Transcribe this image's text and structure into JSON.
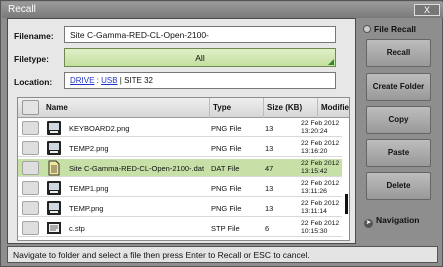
{
  "window": {
    "title": "Recall",
    "close_label": "X"
  },
  "form": {
    "filename_label": "Filename:",
    "filename_value": "Site C-Gamma-RED-CL-Open-2100-",
    "filetype_label": "Filetype:",
    "filetype_value": "All",
    "location_label": "Location:",
    "location_drive": "DRIVE",
    "location_sep1": " : ",
    "location_usb": "USB",
    "location_rest": " | SITE 32"
  },
  "table": {
    "headers": {
      "name": "Name",
      "type": "Type",
      "size": "Size (KB)",
      "modified": "Modified"
    },
    "sort_indicator": "chevron-down",
    "rows": [
      {
        "name": "KEYBOARD2.png",
        "type": "PNG File",
        "size": "13",
        "modified_date": "22 Feb 2012",
        "modified_time": "13:20:24",
        "icon": "image-file-icon",
        "selected": false
      },
      {
        "name": "TEMP2.png",
        "type": "PNG File",
        "size": "13",
        "modified_date": "22 Feb 2012",
        "modified_time": "13:16:20",
        "icon": "image-file-icon",
        "selected": false
      },
      {
        "name": "Site C-Gamma-RED-CL-Open-2100-.dat",
        "type": "DAT File",
        "size": "47",
        "modified_date": "22 Feb 2012",
        "modified_time": "13:15:42",
        "icon": "data-file-icon",
        "selected": true
      },
      {
        "name": "TEMP1.png",
        "type": "PNG File",
        "size": "13",
        "modified_date": "22 Feb 2012",
        "modified_time": "13:11:26",
        "icon": "image-file-icon",
        "selected": false
      },
      {
        "name": "TEMP.png",
        "type": "PNG File",
        "size": "13",
        "modified_date": "22 Feb 2012",
        "modified_time": "13:11:14",
        "icon": "image-file-icon",
        "selected": false
      },
      {
        "name": "c.stp",
        "type": "STP File",
        "size": "6",
        "modified_date": "22 Feb 2012",
        "modified_time": "10:15:30",
        "icon": "setup-file-icon",
        "selected": false
      }
    ]
  },
  "side": {
    "radio_label": "File Recall",
    "buttons": {
      "recall": "Recall",
      "create_folder": "Create Folder",
      "copy": "Copy",
      "paste": "Paste",
      "delete": "Delete"
    },
    "navigation_label": "Navigation"
  },
  "status": {
    "text": "Navigate to folder and select a file then press Enter to Recall or ESC to cancel."
  },
  "colors": {
    "selected_row": "#c7e0a7",
    "filetype_bg": "#cfe5b0",
    "link": "#2233cc"
  }
}
